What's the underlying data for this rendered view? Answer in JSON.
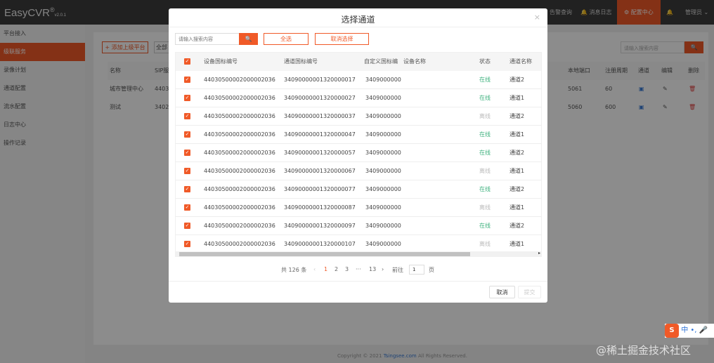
{
  "app": {
    "logo": "EasyCVR",
    "logo_mark": "®",
    "version": "v2.0.1"
  },
  "topnav": {
    "item1": "告警查询",
    "item2": "消息日志",
    "item3": "配置中心",
    "user": "管理员"
  },
  "sidebar": [
    "平台接入",
    "级联服务",
    "录像计划",
    "通道配置",
    "流水配置",
    "日志中心",
    "操作记录"
  ],
  "main": {
    "add_button": "添加上级平台",
    "filter": "全部",
    "search_placeholder": "请输入搜索内容",
    "headers": [
      "名称",
      "SIP服务",
      "本地端口",
      "注册周期",
      "通道",
      "编辑",
      "删除"
    ],
    "rows": [
      {
        "name": "城市管理中心",
        "sip": "4403",
        "port": "5061",
        "period": "60"
      },
      {
        "name": "测试",
        "sip": "3402",
        "port": "5060",
        "period": "600"
      }
    ]
  },
  "footer": {
    "prefix": "Copyright © 2021 ",
    "link": "Tsingsee.com",
    "suffix": " All Rights Reserved."
  },
  "modal": {
    "title": "选择通道",
    "close": "×",
    "search_placeholder": "请输入搜索内容",
    "search_icon": "🔍",
    "select_all": "全选",
    "deselect": "取消选择",
    "headers": [
      "设备国标编号",
      "通道国标编号",
      "自定义国标编",
      "设备名称",
      "状态",
      "通道名称"
    ],
    "rows": [
      {
        "device": "44030500002000002036",
        "channel": "34090000001320000017",
        "custom": "3409000000",
        "name": "",
        "status": "在线",
        "online": true,
        "chname": "通道2"
      },
      {
        "device": "44030500002000002036",
        "channel": "34090000001320000027",
        "custom": "3409000000",
        "name": "",
        "status": "在线",
        "online": true,
        "chname": "通道1"
      },
      {
        "device": "44030500002000002036",
        "channel": "34090000001320000037",
        "custom": "3409000000",
        "name": "",
        "status": "离线",
        "online": false,
        "chname": "通道2"
      },
      {
        "device": "44030500002000002036",
        "channel": "34090000001320000047",
        "custom": "3409000000",
        "name": "",
        "status": "在线",
        "online": true,
        "chname": "通道1"
      },
      {
        "device": "44030500002000002036",
        "channel": "34090000001320000057",
        "custom": "3409000000",
        "name": "",
        "status": "在线",
        "online": true,
        "chname": "通道2"
      },
      {
        "device": "44030500002000002036",
        "channel": "34090000001320000067",
        "custom": "3409000000",
        "name": "",
        "status": "离线",
        "online": false,
        "chname": "通道1"
      },
      {
        "device": "44030500002000002036",
        "channel": "34090000001320000077",
        "custom": "3409000000",
        "name": "",
        "status": "在线",
        "online": true,
        "chname": "通道2"
      },
      {
        "device": "44030500002000002036",
        "channel": "34090000001320000087",
        "custom": "3409000000",
        "name": "",
        "status": "离线",
        "online": false,
        "chname": "通道1"
      },
      {
        "device": "44030500002000002036",
        "channel": "34090000001320000097",
        "custom": "3409000000",
        "name": "",
        "status": "在线",
        "online": true,
        "chname": "通道2"
      },
      {
        "device": "44030500002000002036",
        "channel": "34090000001320000107",
        "custom": "3409000000",
        "name": "",
        "status": "离线",
        "online": false,
        "chname": "通道1"
      }
    ],
    "pagination": {
      "total": "共 126 条",
      "prev": "‹",
      "pages": [
        "1",
        "2",
        "3",
        "···",
        "13"
      ],
      "next": "›",
      "goto": "前往",
      "page_value": "1",
      "page_unit": "页",
      "current": 1
    },
    "cancel": "取消",
    "submit": "提交"
  },
  "ime": {
    "logo": "S",
    "lang": "中",
    "punct": "•,"
  },
  "watermark": "@稀土掘金技术社区",
  "colors": {
    "accent": "#f05a28",
    "online": "#3fb27f",
    "offline": "#bbbbbb"
  }
}
